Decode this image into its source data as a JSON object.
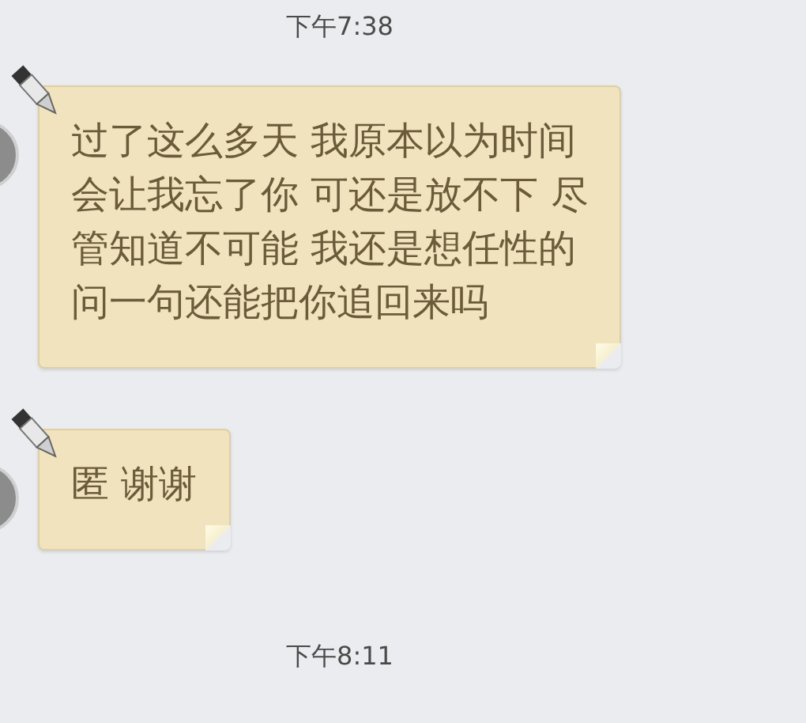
{
  "messages": [
    {
      "kind": "time",
      "text": "下午7:38"
    },
    {
      "kind": "bubble",
      "lines": [
        "过了这么多天 我原本以为时间",
        "会让我忘了你 可还是放不下 尽",
        "管知道不可能 我还是想任性的",
        "问一句还能把你追回来吗"
      ]
    },
    {
      "kind": "bubble",
      "lines": [
        "匿 谢谢"
      ]
    },
    {
      "kind": "time",
      "text": "下午8:11"
    }
  ]
}
